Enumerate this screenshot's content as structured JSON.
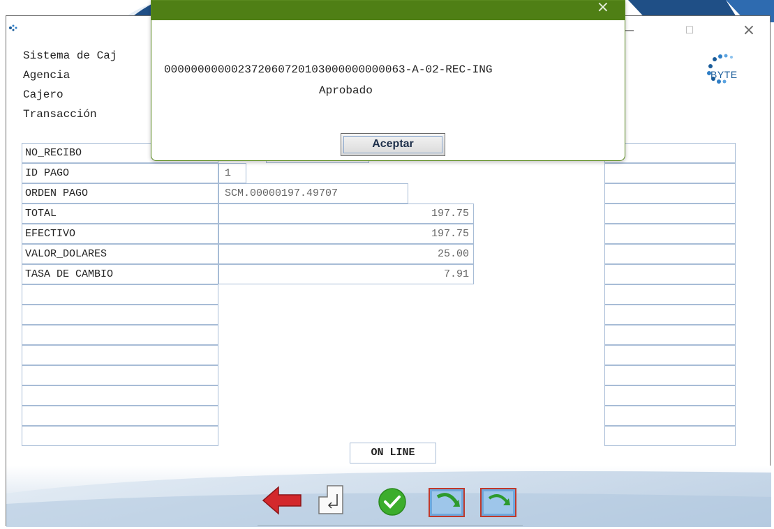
{
  "window": {
    "min_glyph": "—",
    "max_glyph": "☐",
    "close_glyph": "×"
  },
  "header": {
    "system_label": "Sistema de Caj",
    "agency_label": "Agencia",
    "cashier_label": "Cajero",
    "transaction_label": "Transacción",
    "logo_text": "BYTE",
    "logo_small_text": "BYTE"
  },
  "table": {
    "rows": [
      {
        "label": "NO_RECIBO",
        "value": ""
      },
      {
        "label": "ID PAGO",
        "value": "1"
      },
      {
        "label": "ORDEN PAGO",
        "value": "SCM.00000197.49707"
      },
      {
        "label": "TOTAL",
        "value": "197.75"
      },
      {
        "label": "EFECTIVO",
        "value": "197.75"
      },
      {
        "label": "VALOR_DOLARES",
        "value": "25.00"
      },
      {
        "label": "TASA DE CAMBIO",
        "value": "7.91"
      }
    ]
  },
  "status": {
    "online": "ON LINE"
  },
  "dialog": {
    "close_glyph": "×",
    "message": "000000000002372060720103000000000063-A-02-REC-ING",
    "status": "Aprobado",
    "accept_label": "Aceptar"
  },
  "toolbar": {
    "icons": [
      "back-arrow-icon",
      "enter-key-icon",
      "confirm-check-icon",
      "print-green-arrow-icon",
      "print-icon"
    ]
  },
  "colors": {
    "dialog_title": "#4f7f15",
    "cell_border": "#a7bcd6",
    "logo_blue": "#1a5c9a"
  }
}
